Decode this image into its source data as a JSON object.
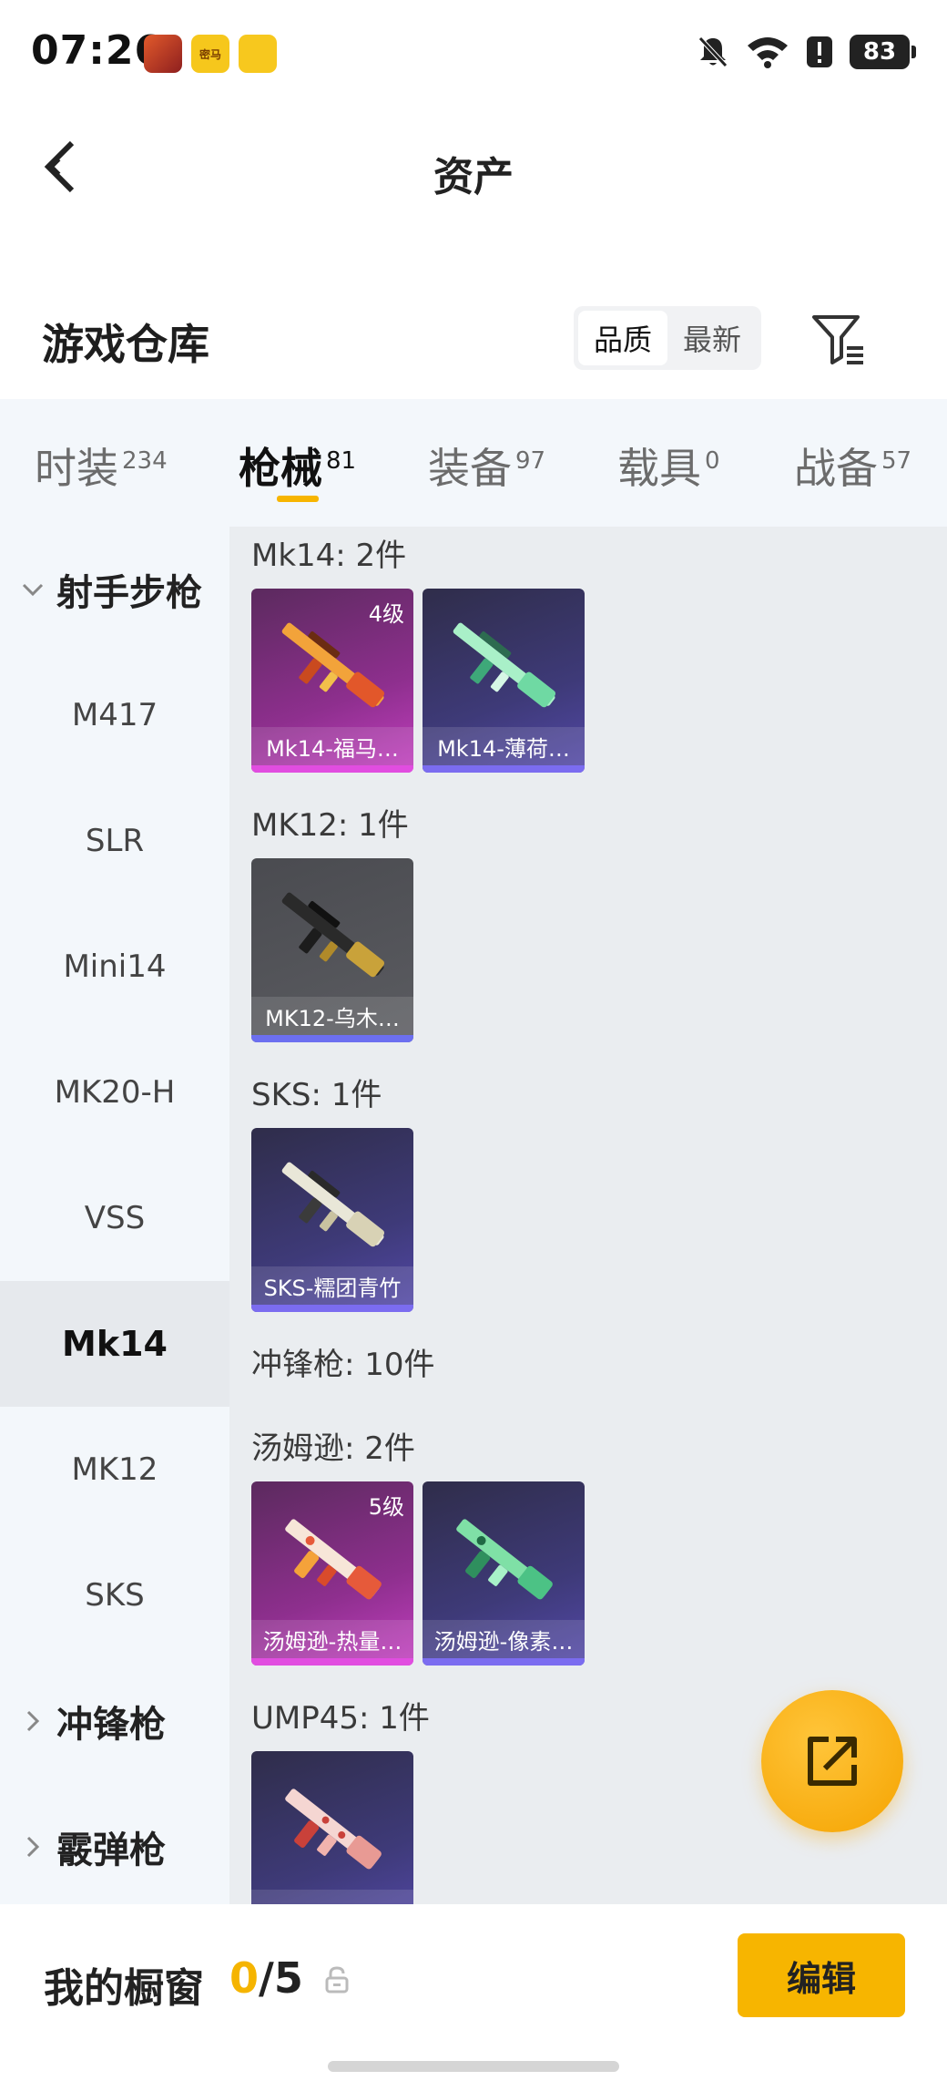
{
  "status_bar": {
    "time": "07:26",
    "app_icons": [
      {
        "name": "game-icon-1",
        "label": "",
        "color": "#c0392b"
      },
      {
        "name": "mima-app-icon",
        "label": "密马",
        "color": "#f6c71c"
      },
      {
        "name": "game-icon-3",
        "label": "",
        "color": "#f7c81e"
      }
    ],
    "battery": "83"
  },
  "nav": {
    "title": "资产"
  },
  "section": {
    "title": "游戏仓库",
    "sort_options": [
      "品质",
      "最新"
    ],
    "active_sort": "品质"
  },
  "tabs": [
    {
      "label": "时装",
      "count": "234"
    },
    {
      "label": "枪械",
      "count": "81"
    },
    {
      "label": "装备",
      "count": "97"
    },
    {
      "label": "载具",
      "count": "0"
    },
    {
      "label": "战备",
      "count": "57"
    }
  ],
  "active_tab": "枪械",
  "sidebar": {
    "group_sniper": "射手步枪",
    "items": [
      "M417",
      "SLR",
      "Mini14",
      "MK20-H",
      "VSS",
      "Mk14",
      "MK12",
      "SKS"
    ],
    "active_item": "Mk14",
    "group_smg": "冲锋枪",
    "group_shotgun": "霰弹枪"
  },
  "content": {
    "groups": [
      {
        "label": "Mk14: 2件"
      },
      {
        "label": "MK12: 1件"
      },
      {
        "label": "SKS: 1件"
      },
      {
        "label": "冲锋枪: 10件"
      },
      {
        "label": "汤姆逊: 2件"
      },
      {
        "label": "UMP45: 1件"
      }
    ],
    "cards": [
      {
        "caption": "Mk14-福马…",
        "level": "4级",
        "rarity": "pink"
      },
      {
        "caption": "Mk14-薄荷…",
        "level": "",
        "rarity": "purple"
      },
      {
        "caption": "MK12-乌木…",
        "level": "",
        "rarity": "grey"
      },
      {
        "caption": "SKS-糯团青竹",
        "level": "",
        "rarity": "purple"
      },
      {
        "caption": "汤姆逊-热量…",
        "level": "5级",
        "rarity": "pink"
      },
      {
        "caption": "汤姆逊-像素…",
        "level": "",
        "rarity": "purple"
      },
      {
        "caption": "",
        "level": "",
        "rarity": "purple"
      }
    ]
  },
  "bottom": {
    "showcase_label": "我的橱窗",
    "showcase_current": "0",
    "showcase_total": "/5",
    "edit_label": "编辑"
  },
  "colors": {
    "accent": "#f7b500",
    "tab_bg": "#f3f7fb",
    "content_bg": "#eaedf0"
  }
}
